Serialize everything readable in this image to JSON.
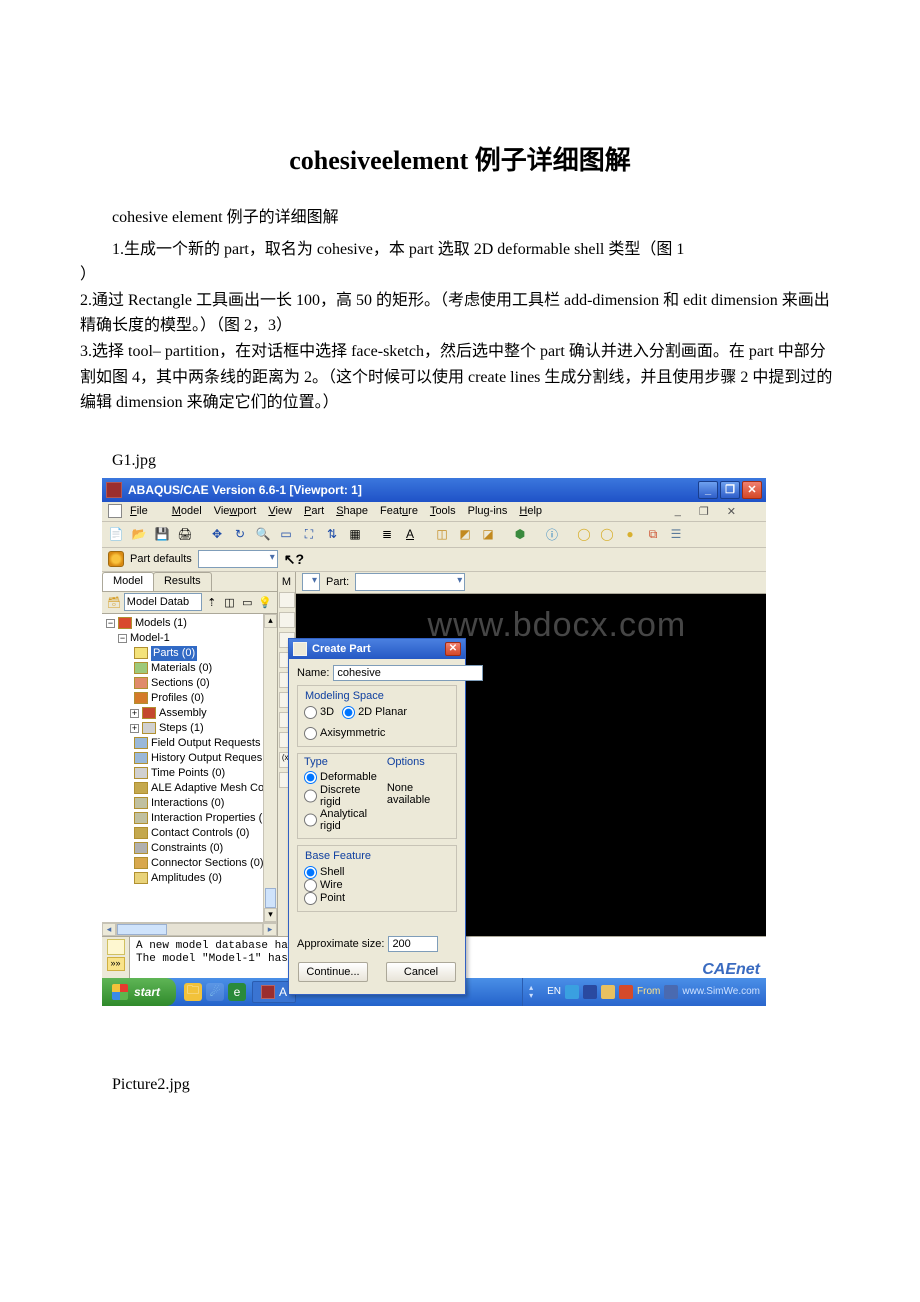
{
  "title": "cohesiveelement 例子详细图解",
  "intro": "cohesive element 例子的详细图解",
  "steps": {
    "s1_indent": "1.生成一个新的 part，取名为 cohesive，本 part 选取 2D deformable shell 类型（图 1",
    "s1_hang": "）",
    "s2": "2.通过 Rectangle 工具画出一长 100，高 50 的矩形。（考虑使用工具栏 add-dimension 和 edit dimension 来画出精确长度的模型。）（图 2，3）",
    "s3": "3.选择 tool– partition，在对话框中选择 face-sketch，然后选中整个 part 确认并进入分割画面。在 part 中部分割如图 4，其中两条线的距离为 2。（这个时候可以使用 create lines 生成分割线，并且使用步骤 2 中提到过的编辑 dimension 来确定它们的位置。）"
  },
  "captions": {
    "g1": "G1.jpg",
    "p2": "Picture2.jpg"
  },
  "app": {
    "title": "ABAQUS/CAE Version 6.6-1 [Viewport: 1]",
    "menus": [
      "File",
      "Model",
      "Viewport",
      "View",
      "Part",
      "Shape",
      "Feature",
      "Tools",
      "Plug-ins",
      "Help"
    ],
    "part_defaults": "Part defaults",
    "module_label": "M",
    "part_label": "Part:",
    "watermark": "www.bdocx.com",
    "msg1": "A new model database ha",
    "msg2": "The model \"Model-1\" has",
    "caenet": "CAEnet"
  },
  "tree": {
    "tabs": [
      "Model",
      "Results"
    ],
    "header": "Model Datab",
    "root": "Models (1)",
    "model": "Model-1",
    "items": [
      "Parts (0)",
      "Materials (0)",
      "Sections (0)",
      "Profiles (0)",
      "Assembly",
      "Steps (1)",
      "Field Output Requests",
      "History Output Reques",
      "Time Points (0)",
      "ALE Adaptive Mesh Con",
      "Interactions (0)",
      "Interaction Properties (",
      "Contact Controls (0)",
      "Constraints (0)",
      "Connector Sections (0)",
      "Amplitudes (0)"
    ]
  },
  "dialog": {
    "title": "Create Part",
    "name_label": "Name:",
    "name_value": "cohesive",
    "modeling_space": "Modeling Space",
    "ms_3d": "3D",
    "ms_2d": "2D Planar",
    "ms_axi": "Axisymmetric",
    "type_title": "Type",
    "options_title": "Options",
    "t_def": "Deformable",
    "t_disc": "Discrete rigid",
    "t_anal": "Analytical rigid",
    "opt_none": "None available",
    "basefeat": "Base Feature",
    "bf_shell": "Shell",
    "bf_wire": "Wire",
    "bf_point": "Point",
    "approx_label": "Approximate size:",
    "approx_value": "200",
    "continue": "Continue...",
    "cancel": "Cancel"
  },
  "taskbar": {
    "start": "start",
    "task_label": "A",
    "lang": "EN",
    "from": "From",
    "url": "www.SimWe.com"
  }
}
